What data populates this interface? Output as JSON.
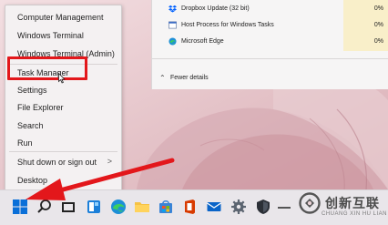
{
  "winx_menu": {
    "items": [
      {
        "label": "Computer Management"
      },
      {
        "label": "Windows Terminal"
      },
      {
        "label": "Windows Terminal (Admin)"
      },
      {
        "label": "Task Manager"
      },
      {
        "label": "Settings"
      },
      {
        "label": "File Explorer"
      },
      {
        "label": "Search"
      },
      {
        "label": "Run"
      },
      {
        "label": "Shut down or sign out"
      },
      {
        "label": "Desktop"
      }
    ],
    "submenu_arrow": ">"
  },
  "task_manager": {
    "processes": [
      {
        "name": "Dropbox Update (32 bit)",
        "cpu": "0%",
        "icon": "dropbox-icon"
      },
      {
        "name": "Host Process for Windows Tasks",
        "cpu": "0%",
        "icon": "windows-process-icon"
      },
      {
        "name": "Microsoft Edge",
        "cpu": "0%",
        "icon": "edge-icon"
      }
    ],
    "fewer_details_label": "Fewer details"
  },
  "taskbar": {
    "icons": [
      "start-icon",
      "search-icon",
      "task-view-icon",
      "widgets-icon",
      "edge-icon",
      "file-explorer-icon",
      "store-icon",
      "office-icon",
      "mail-icon",
      "settings-icon",
      "security-icon"
    ]
  },
  "watermark": {
    "text": "创新互联",
    "subtext": "CHUANG XIN HU LIAN"
  },
  "colors": {
    "highlight_red": "#e3171b",
    "windows_blue": "#0a6fd8"
  }
}
